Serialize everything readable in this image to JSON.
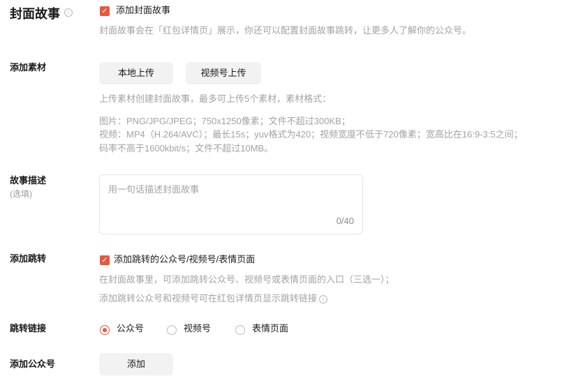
{
  "cover_story": {
    "title": "封面故事",
    "info_icon": "info-icon",
    "checkbox_label": "添加封面故事",
    "checked": true,
    "description": "封面故事会在「红包详情页」展示，你还可以配置封面故事跳转，让更多人了解你的公众号。"
  },
  "materials": {
    "label": "添加素材",
    "local_upload": "本地上传",
    "channels_upload": "视频号上传",
    "hint_intro": "上传素材创建封面故事，最多可上传5个素材，素材格式：",
    "hint_image": "图片：PNG/JPG/JPEG；750x1250像素；文件不超过300KB；",
    "hint_video": "视频：MP4（H.264/AVC）；最长15s；yuv格式为420；视频宽度不低于720像素；宽高比在16:9-3:5之间；",
    "hint_bitrate": "码率不高于1600kbit/s；文件不超过10MB。"
  },
  "description_field": {
    "label": "故事描述",
    "optional": "(选填)",
    "placeholder": "用一句话描述封面故事",
    "count": "0/40"
  },
  "jump": {
    "label": "添加跳转",
    "checkbox_label": "添加跳转的公众号/视频号/表情页面",
    "checked": true,
    "hint_1": "在封面故事里，可添加跳转公众号、视频号或表情页面的入口（三选一）；",
    "hint_2": "添加跳转公众号和视频号可在红包详情页显示跳转链接"
  },
  "jump_link": {
    "label": "跳转链接",
    "options": [
      "公众号",
      "视频号",
      "表情页面"
    ],
    "selected": "公众号"
  },
  "add_account": {
    "label": "添加公众号",
    "button": "添加"
  },
  "colors": {
    "accent": "#e8573f",
    "hint_text": "#a3a3a3",
    "button_bg": "#f2f2f2"
  }
}
